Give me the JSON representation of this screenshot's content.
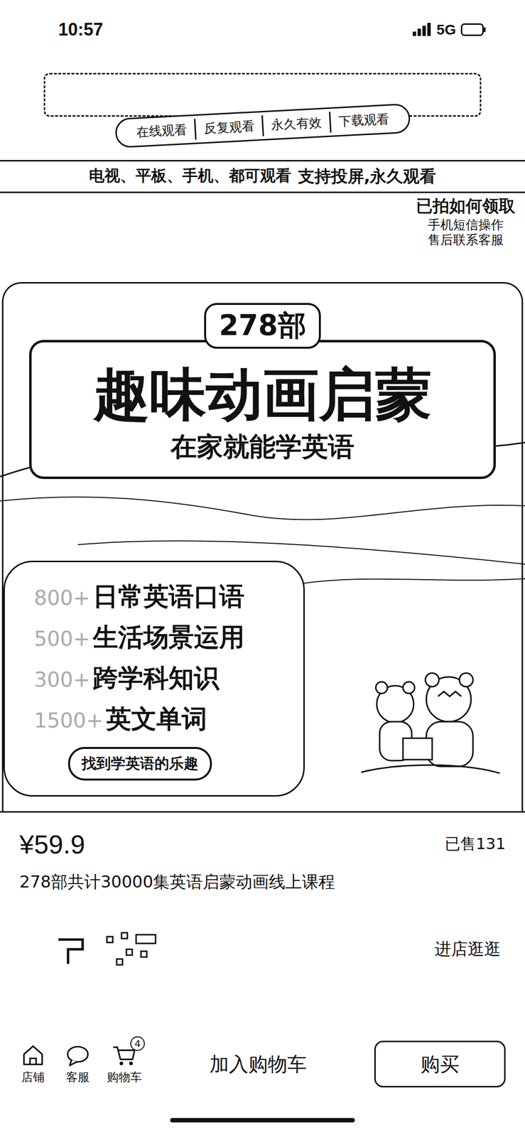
{
  "status_bar": {
    "time": "10:57",
    "network": "5G"
  },
  "banner": {
    "tags": [
      "在线观看",
      "反复观看",
      "永久有效",
      "下载观看"
    ],
    "devices": "电视、平板、手机、都可观看",
    "highlight": "支持投屏,永久观看",
    "claim": {
      "title": "已拍如何领取",
      "lines": [
        "手机短信操作",
        "售后联系客服"
      ]
    },
    "count": "278部",
    "headline": "趣味动画启蒙",
    "subtitle": "在家就能学英语",
    "features": [
      {
        "count": "800+",
        "label": "日常英语口语"
      },
      {
        "count": "500+",
        "label": "生活场景运用"
      },
      {
        "count": "300+",
        "label": "跨学科知识"
      },
      {
        "count": "1500+",
        "label": "英文单词"
      }
    ],
    "cta": "找到学英语的乐趣"
  },
  "product": {
    "price": "¥59.9",
    "sold": "已售131",
    "title": "278部共计30000集英语启蒙动画线上课程"
  },
  "store": {
    "action": "进店逛逛"
  },
  "action_bar": {
    "icons": [
      {
        "label": "店铺",
        "kind": "store"
      },
      {
        "label": "客服",
        "kind": "chat"
      },
      {
        "label": "购物车",
        "kind": "cart",
        "badge": "4"
      }
    ],
    "add_to_cart": "加入购物车",
    "buy": "购买"
  }
}
